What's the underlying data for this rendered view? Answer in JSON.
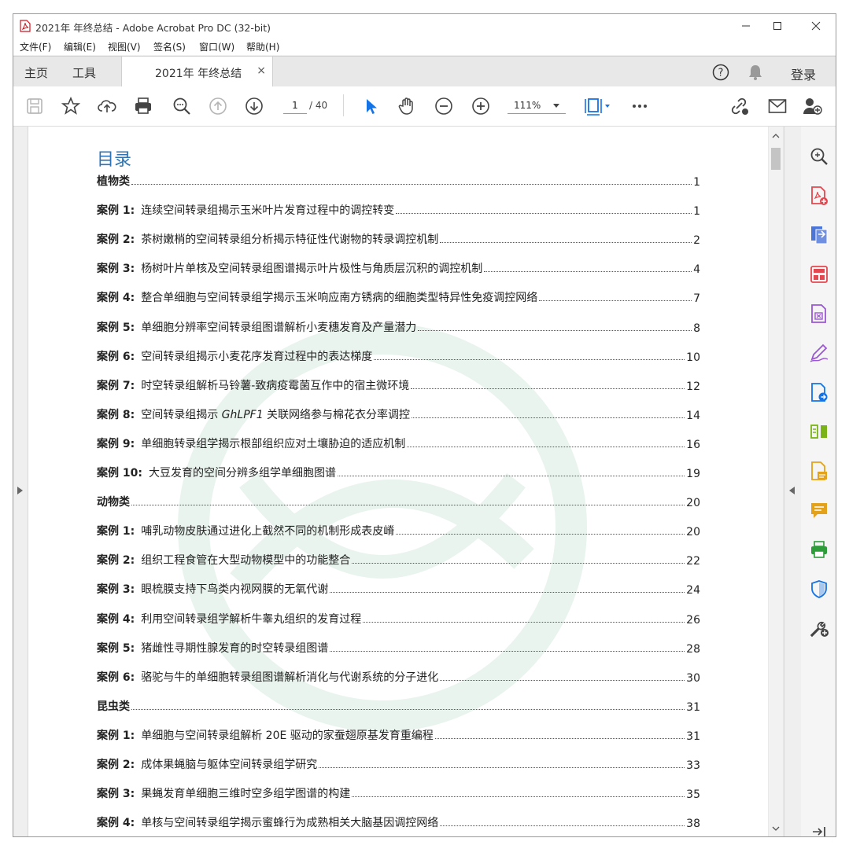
{
  "window": {
    "title": "2021年 年终总结 - Adobe Acrobat Pro DC (32-bit)"
  },
  "menu": [
    "文件(F)",
    "编辑(E)",
    "视图(V)",
    "签名(S)",
    "窗口(W)",
    "帮助(H)"
  ],
  "tabs": {
    "home": "主页",
    "tools": "工具",
    "document": "2021年 年终总结",
    "close": "×",
    "login": "登录"
  },
  "toolbar": {
    "page_current": "1",
    "page_total": "/ 40",
    "zoom": "111%"
  },
  "toc": {
    "title": "目录",
    "entries": [
      {
        "label": "植物类",
        "text": "",
        "page": "1"
      },
      {
        "label": "案例 1:",
        "text": "连续空间转录组揭示玉米叶片发育过程中的调控转变",
        "page": "1"
      },
      {
        "label": "案例 2:",
        "text": "茶树嫩梢的空间转录组分析揭示特征性代谢物的转录调控机制",
        "page": "2"
      },
      {
        "label": "案例 3:",
        "text": "杨树叶片单核及空间转录组图谱揭示叶片极性与角质层沉积的调控机制",
        "page": "4"
      },
      {
        "label": "案例 4:",
        "text": "整合单细胞与空间转录组学揭示玉米响应南方锈病的细胞类型特异性免疫调控网络",
        "page": "7"
      },
      {
        "label": "案例 5:",
        "text": "单细胞分辨率空间转录组图谱解析小麦穗发育及产量潜力",
        "page": "8"
      },
      {
        "label": "案例 6:",
        "text": "空间转录组揭示小麦花序发育过程中的表达梯度",
        "page": "10"
      },
      {
        "label": "案例 7:",
        "text": "时空转录组解析马铃薯-致病疫霉菌互作中的宿主微环境",
        "page": "12"
      },
      {
        "label": "案例 8:",
        "text": "空间转录组揭示 GhLPF1 关联网络参与棉花衣分率调控",
        "page": "14"
      },
      {
        "label": "案例 9:",
        "text": "单细胞转录组学揭示根部组织应对土壤胁迫的适应机制",
        "page": "16"
      },
      {
        "label": "案例 10:",
        "text": "大豆发育的空间分辨多组学单细胞图谱",
        "page": "19"
      },
      {
        "label": "动物类",
        "text": "",
        "page": "20"
      },
      {
        "label": "案例 1:",
        "text": "哺乳动物皮肤通过进化上截然不同的机制形成表皮嵴",
        "page": "20"
      },
      {
        "label": "案例 2:",
        "text": "组织工程食管在大型动物模型中的功能整合",
        "page": "22"
      },
      {
        "label": "案例 3:",
        "text": "眼梳膜支持下鸟类内视网膜的无氧代谢",
        "page": "24"
      },
      {
        "label": "案例 4:",
        "text": "利用空间转录组学解析牛睾丸组织的发育过程",
        "page": "26"
      },
      {
        "label": "案例 5:",
        "text": "猪雌性寻期性腺发育的时空转录组图谱",
        "page": "28"
      },
      {
        "label": "案例 6:",
        "text": "骆驼与牛的单细胞转录组图谱解析消化与代谢系统的分子进化",
        "page": "30"
      },
      {
        "label": "昆虫类",
        "text": "",
        "page": "31"
      },
      {
        "label": "案例 1:",
        "text": "单细胞与空间转录组解析 20E 驱动的家蚕翅原基发育重编程",
        "page": "31"
      },
      {
        "label": "案例 2:",
        "text": "成体果蝇脑与躯体空间转录组学研究",
        "page": "33"
      },
      {
        "label": "案例 3:",
        "text": "果蝇发育单细胞三维时空多组学图谱的构建",
        "page": "35"
      },
      {
        "label": "案例 4:",
        "text": "单核与空间转录组学揭示蜜蜂行为成熟相关大脑基因调控网络",
        "page": "38"
      }
    ]
  }
}
